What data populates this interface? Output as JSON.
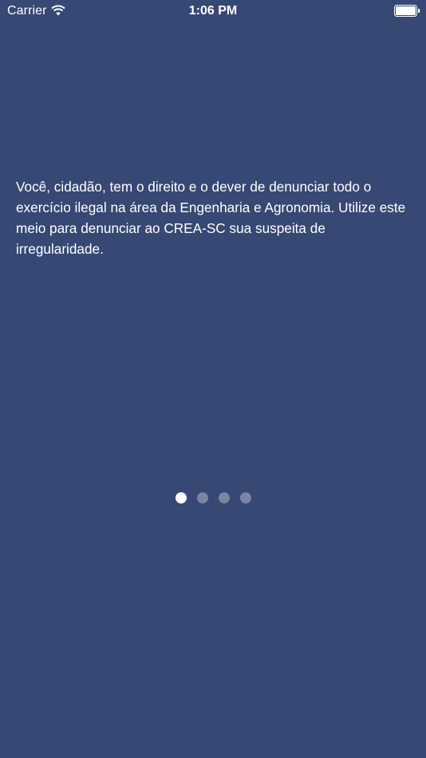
{
  "status_bar": {
    "carrier": "Carrier",
    "time": "1:06 PM",
    "icons": [
      "wifi-icon",
      "battery-icon"
    ]
  },
  "onboarding": {
    "message": "Você, cidadão, tem o direito e o dever de denunciar todo o exercício ilegal na área da Engenharia e Agronomia. Utilize este meio para denunciar ao CREA-SC sua suspeita de irregularidade."
  },
  "page_control": {
    "total_pages": 4,
    "current_page": 1
  },
  "colors": {
    "background": "#364873",
    "text": "#ffffff",
    "dot_active": "#ffffff",
    "dot_inactive": "#7a85a3"
  }
}
